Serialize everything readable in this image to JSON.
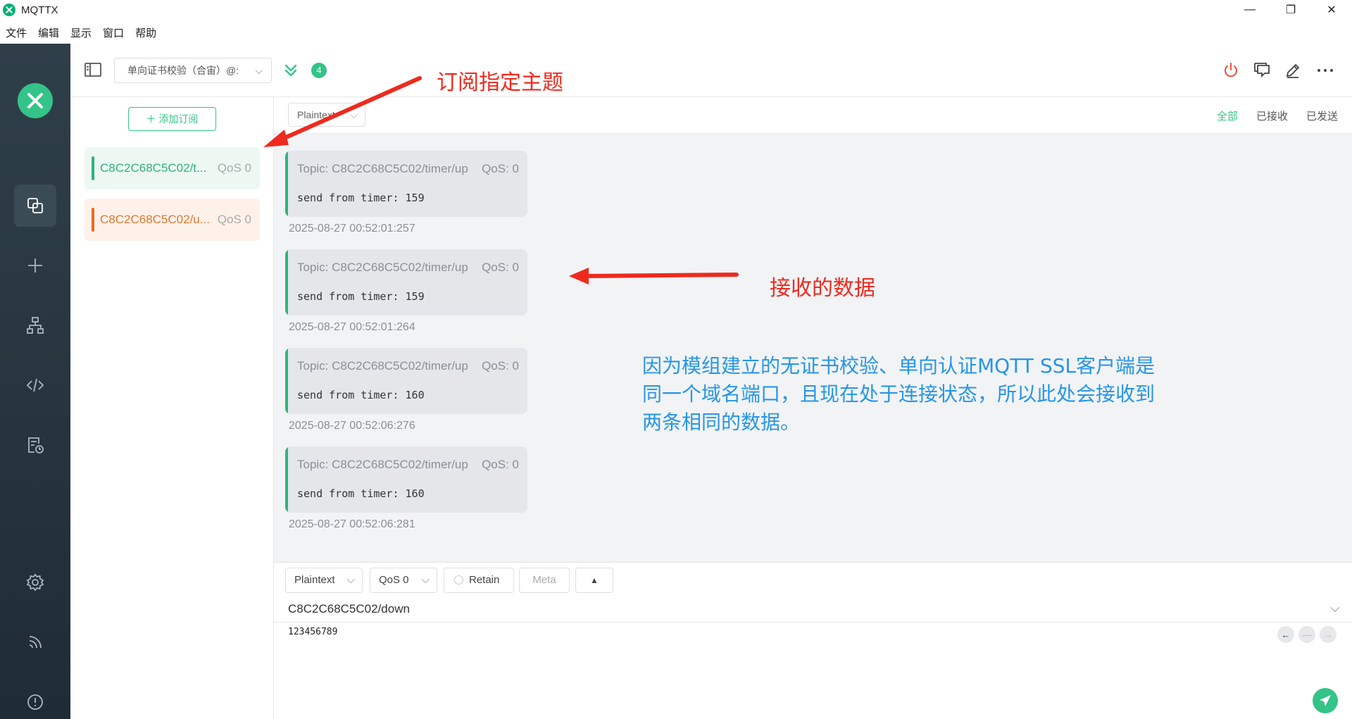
{
  "window": {
    "title": "MQTTX",
    "minimize": "—",
    "restore": "❐",
    "close": "✕"
  },
  "menu": [
    "文件",
    "编辑",
    "显示",
    "窗口",
    "帮助"
  ],
  "header": {
    "connection_name": "单向证书校验（合宙）@:",
    "connection_count": "4"
  },
  "subscriptions": {
    "add_label": "添加订阅",
    "items": [
      {
        "topic": "C8C2C68C5C02/t...",
        "qos": "QoS 0",
        "color": "#2eb47c"
      },
      {
        "topic": "C8C2C68C5C02/u...",
        "qos": "QoS 0",
        "color": "#e66d22"
      }
    ]
  },
  "messages": {
    "format": "Plaintext",
    "filters": [
      "全部",
      "已接收",
      "已发送"
    ],
    "items": [
      {
        "topic": "Topic: C8C2C68C5C02/timer/up",
        "qos": "QoS: 0",
        "payload": "send from timer: 159",
        "time": "2025-08-27 00:52:01:257"
      },
      {
        "topic": "Topic: C8C2C68C5C02/timer/up",
        "qos": "QoS: 0",
        "payload": "send from timer: 159",
        "time": "2025-08-27 00:52:01:264"
      },
      {
        "topic": "Topic: C8C2C68C5C02/timer/up",
        "qos": "QoS: 0",
        "payload": "send from timer: 160",
        "time": "2025-08-27 00:52:06:276"
      },
      {
        "topic": "Topic: C8C2C68C5C02/timer/up",
        "qos": "QoS: 0",
        "payload": "send from timer: 160",
        "time": "2025-08-27 00:52:06:281"
      }
    ]
  },
  "publish": {
    "format": "Plaintext",
    "qos": "QoS 0",
    "retain": "Retain",
    "meta": "Meta",
    "topic": "C8C2C68C5C02/down",
    "payload": "123456789"
  },
  "annotations": {
    "subscribe_label": "订阅指定主题",
    "received_label": "接收的数据",
    "note_lines": [
      "因为模组建立的无证书校验、单向认证MQTT SSL客户端是",
      "同一个域名端口，且现在处于连接状态，所以此处会接收到",
      "两条相同的数据。"
    ]
  },
  "colors": {
    "accent": "#34c388",
    "annotation_red": "#ee2a1e",
    "annotation_blue": "#2696e8",
    "nav_bg": "#2b3a44"
  },
  "icons": [
    "app-logo-icon",
    "panel-toggle-icon",
    "expand-icon",
    "power-icon",
    "comment-icon",
    "edit-icon",
    "more-icon",
    "connections-icon",
    "plus-icon",
    "topology-icon",
    "code-icon",
    "log-icon",
    "settings-icon",
    "subscribe-icon",
    "info-icon",
    "send-icon"
  ]
}
